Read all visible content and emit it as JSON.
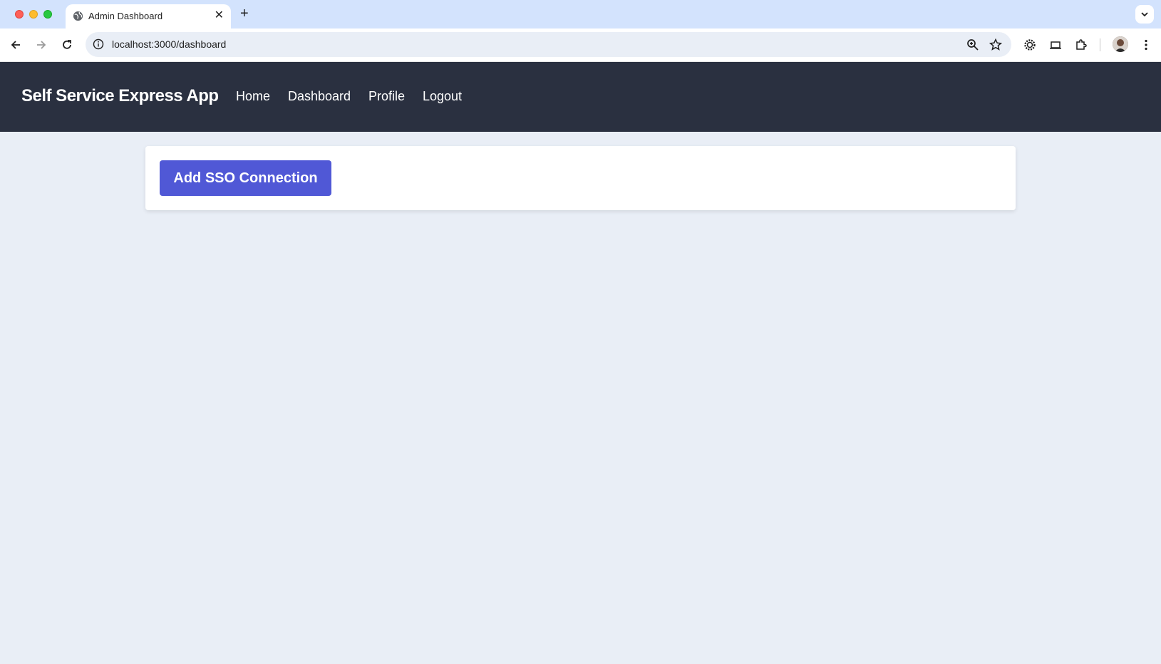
{
  "browser": {
    "tab_title": "Admin Dashboard",
    "tab_close": "✕",
    "new_tab": "+",
    "url": "localhost:3000/dashboard",
    "icons": [
      "globe-icon",
      "back-icon",
      "forward-icon",
      "reload-icon",
      "info-icon",
      "zoom-icon",
      "star-icon",
      "extension-gear-icon",
      "cast-icon",
      "puzzle-icon",
      "avatar",
      "more-icon",
      "tab-list-icon"
    ]
  },
  "app": {
    "brand": "Self Service Express App",
    "nav": [
      {
        "label": "Home"
      },
      {
        "label": "Dashboard"
      },
      {
        "label": "Profile"
      },
      {
        "label": "Logout"
      }
    ],
    "add_sso_button": "Add SSO Connection"
  },
  "colors": {
    "header_bg": "#2a3040",
    "body_bg": "#e9eef6",
    "primary_button": "#5058d6",
    "tab_strip": "#d3e3fd"
  }
}
